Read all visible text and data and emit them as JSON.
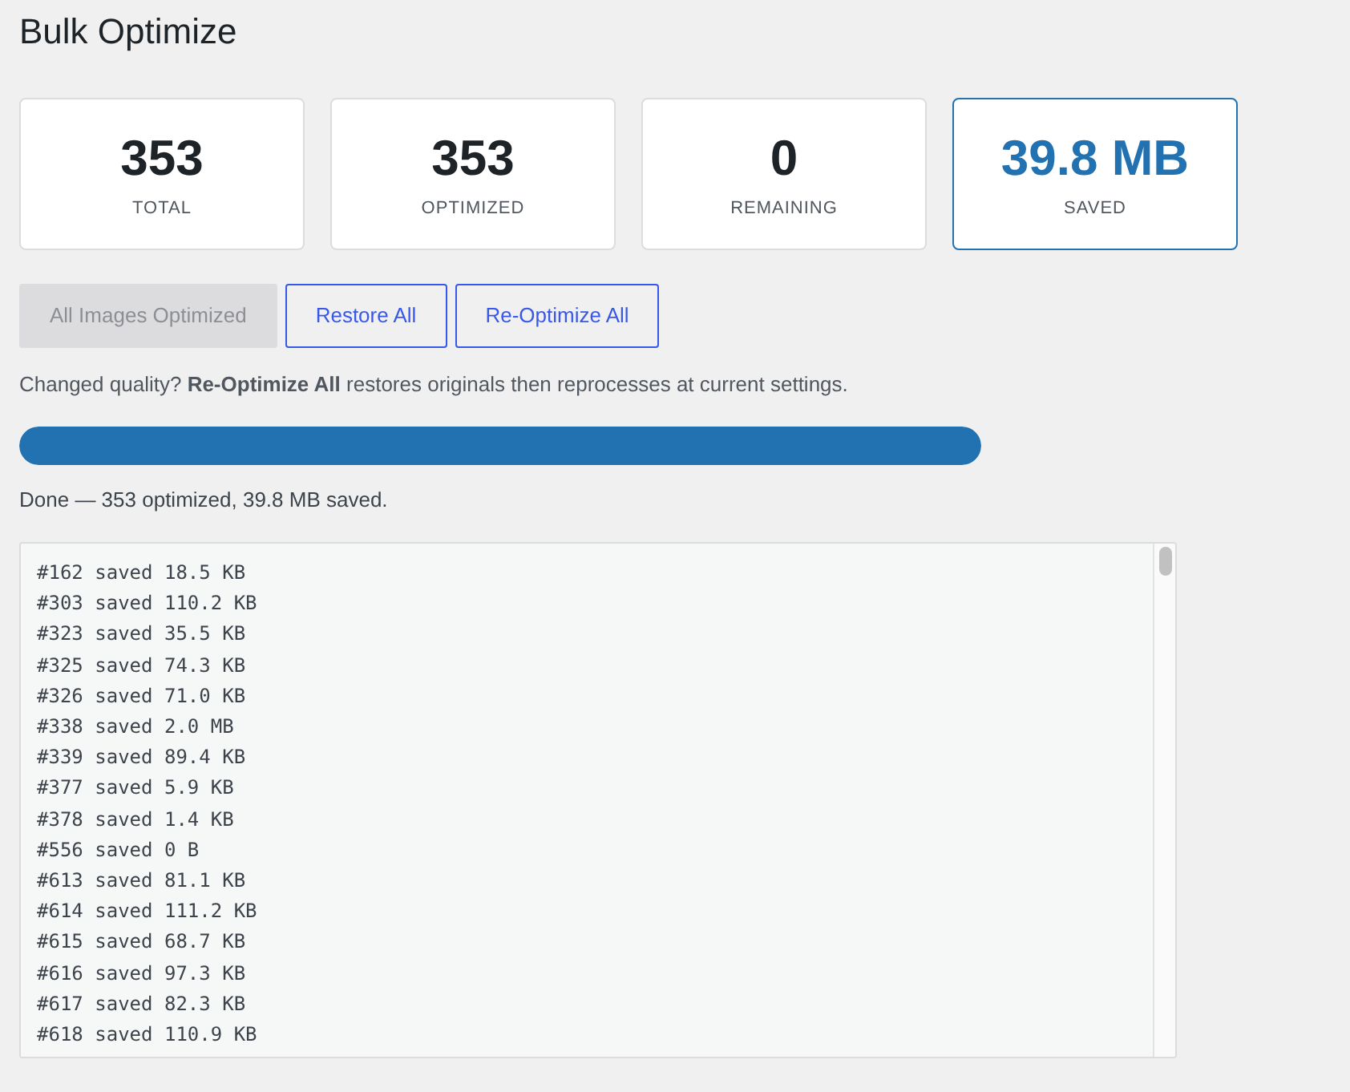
{
  "page_title": "Bulk Optimize",
  "stats": [
    {
      "value": "353",
      "label": "TOTAL",
      "highlighted": false
    },
    {
      "value": "353",
      "label": "OPTIMIZED",
      "highlighted": false
    },
    {
      "value": "0",
      "label": "REMAINING",
      "highlighted": false
    },
    {
      "value": "39.8 MB",
      "label": "SAVED",
      "highlighted": true
    }
  ],
  "buttons": [
    {
      "label": "All Images Optimized",
      "disabled": true
    },
    {
      "label": "Restore All",
      "disabled": false
    },
    {
      "label": "Re-Optimize All",
      "disabled": false
    }
  ],
  "hint": "Changed quality? **Re-Optimize All** restores originals then reprocesses at current settings.",
  "progress": {
    "level": 1
  },
  "status": "Done — 353 optimized, 39.8 MB saved.",
  "log": [
    "#162 saved 18.5 KB",
    "#303 saved 110.2 KB",
    "#323 saved 35.5 KB",
    "#325 saved 74.3 KB",
    "#326 saved 71.0 KB",
    "#338 saved 2.0 MB",
    "#339 saved 89.4 KB",
    "#377 saved 5.9 KB",
    "#378 saved 1.4 KB",
    "#556 saved 0 B",
    "#613 saved 81.1 KB",
    "#614 saved 111.2 KB",
    "#615 saved 68.7 KB",
    "#616 saved 97.3 KB",
    "#617 saved 82.3 KB",
    "#618 saved 110.9 KB"
  ]
}
